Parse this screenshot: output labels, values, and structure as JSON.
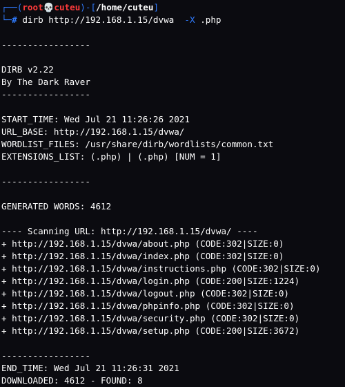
{
  "prompt": {
    "box_open": "┌──(",
    "user": "root",
    "skull": "💀",
    "host": "cuteu",
    "box_mid": ")-[",
    "path": "/home/cuteu",
    "box_close": "]",
    "corner": "└─",
    "hash": "#",
    "command": "dirb http://192.168.1.15/dvwa",
    "option": "-X",
    "option_value": ".php"
  },
  "output": {
    "sep": "-----------------",
    "version": "DIRB v2.22",
    "author": "By The Dark Raver",
    "start_time": "START_TIME: Wed Jul 21 11:26:26 2021",
    "url_base": "URL_BASE: http://192.168.1.15/dvwa/",
    "wordlist": "WORDLIST_FILES: /usr/share/dirb/wordlists/common.txt",
    "extensions": "EXTENSIONS_LIST: (.php) | (.php) [NUM = 1]",
    "generated": "GENERATED WORDS: 4612",
    "scanning": "---- Scanning URL: http://192.168.1.15/dvwa/ ----",
    "results": [
      "+ http://192.168.1.15/dvwa/about.php (CODE:302|SIZE:0)",
      "+ http://192.168.1.15/dvwa/index.php (CODE:302|SIZE:0)",
      "+ http://192.168.1.15/dvwa/instructions.php (CODE:302|SIZE:0)",
      "+ http://192.168.1.15/dvwa/login.php (CODE:200|SIZE:1224)",
      "+ http://192.168.1.15/dvwa/logout.php (CODE:302|SIZE:0)",
      "+ http://192.168.1.15/dvwa/phpinfo.php (CODE:302|SIZE:0)",
      "+ http://192.168.1.15/dvwa/security.php (CODE:302|SIZE:0)",
      "+ http://192.168.1.15/dvwa/setup.php (CODE:200|SIZE:3672)"
    ],
    "end_time": "END_TIME: Wed Jul 21 11:26:31 2021",
    "downloaded": "DOWNLOADED: 4612 - FOUND: 8"
  },
  "colors": {
    "background": "#0b0b10",
    "prompt_blue": "#2f7bff",
    "user_red": "#ff3b3b",
    "text": "#ffffff"
  },
  "icons": {
    "skull": "skull-icon"
  }
}
